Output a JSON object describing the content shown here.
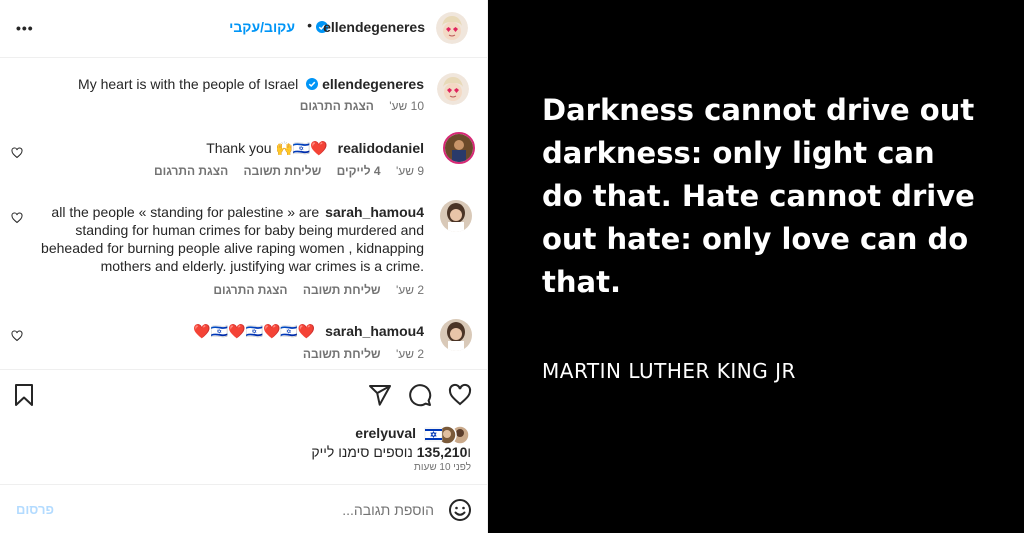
{
  "header": {
    "username": "ellendegeneres",
    "follow_label": "עקוב/עקבי",
    "dot": "•",
    "more_icon": "more-horizontal-icon"
  },
  "comments": [
    {
      "username": "ellendegeneres",
      "text": "My heart is with the people of Israel",
      "verified": true,
      "time": "10 שע'",
      "actions": [
        "הצגת התרגום"
      ]
    },
    {
      "username": "realidodaniel",
      "text": "Thank you 🙌🇮🇱❤️",
      "time": "9 שע'",
      "likes": "4 לייקים",
      "actions": [
        "שליחת תשובה",
        "הצגת התרגום"
      ]
    },
    {
      "username": "sarah_hamou4",
      "text": "all the people «  standing for palestine » are standing for human crimes for baby being murdered and beheaded for burning people alive raping women , kidnapping mothers and elderly. justifying war crimes is a crime.",
      "time": "2 שע'",
      "actions": [
        "שליחת תשובה",
        "הצגת התרגום"
      ]
    },
    {
      "username": "sarah_hamou4",
      "text": "❤️🇮🇱❤️🇮🇱❤️🇮🇱❤️",
      "time": "2 שע'",
      "actions": [
        "שליחת תשובה"
      ]
    }
  ],
  "actions": {
    "icons": [
      "heart-icon",
      "comment-icon",
      "share-icon",
      "save-icon"
    ],
    "liked_by_user": "erelyuval",
    "liked_by_more_prefix": "ו",
    "liked_by_count": "135,210",
    "liked_by_more_suffix": " נוספים סימנו לייק",
    "post_time": "לפני 10 שעות"
  },
  "add_comment": {
    "placeholder": "הוספת תגובה...",
    "post_label": "פרסום",
    "emoji_icon": "emoji-icon"
  },
  "media": {
    "quote": "Darkness cannot drive out darkness: only light can do that. Hate cannot drive out hate: only love can do that.",
    "author": "MARTIN LUTHER KING JR"
  },
  "colors": {
    "link": "#0095f6",
    "meta": "#737373",
    "post_disabled": "#b3dbff",
    "media_bg": "#000000",
    "verified": "#0095f6"
  }
}
